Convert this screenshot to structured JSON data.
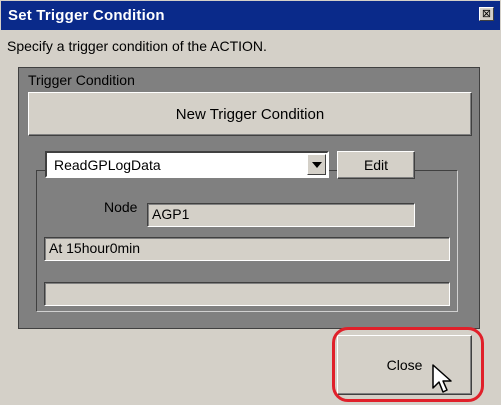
{
  "window": {
    "title": "Set Trigger Condition",
    "close_glyph": "⊠"
  },
  "instruction": "Specify a trigger condition of the ACTION.",
  "trigger_group": {
    "label": "Trigger Condition",
    "new_button": "New Trigger Condition",
    "selected_trigger": "ReadGPLogData",
    "edit_button": "Edit",
    "node_label": "Node",
    "node_value": "AGP1",
    "schedule_value": "At 15hour0min",
    "extra_value": ""
  },
  "footer": {
    "close_button": "Close"
  },
  "colors": {
    "titlebar": "#0a2a8a",
    "highlight": "#e0202a",
    "dialog_bg": "#d4d0c8",
    "panel_bg": "#808080"
  },
  "icons": {
    "close": "close-icon",
    "dropdown": "chevron-down-icon",
    "cursor": "mouse-pointer-icon"
  }
}
